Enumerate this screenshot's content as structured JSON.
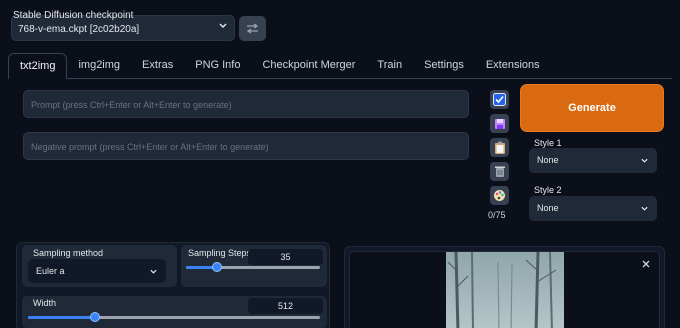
{
  "checkpoint": {
    "label": "Stable Diffusion checkpoint",
    "value": "768-v-ema.ckpt [2c02b20a]"
  },
  "tabs": [
    {
      "label": "txt2img"
    },
    {
      "label": "img2img"
    },
    {
      "label": "Extras"
    },
    {
      "label": "PNG Info"
    },
    {
      "label": "Checkpoint Merger"
    },
    {
      "label": "Train"
    },
    {
      "label": "Settings"
    },
    {
      "label": "Extensions"
    }
  ],
  "prompt": {
    "placeholder": "Prompt (press Ctrl+Enter or Alt+Enter to generate)",
    "negative_placeholder": "Negative prompt (press Ctrl+Enter or Alt+Enter to generate)",
    "token_count": "0/75"
  },
  "generate": {
    "label": "Generate"
  },
  "styles": {
    "style1_label": "Style 1",
    "style1_value": "None",
    "style2_label": "Style 2",
    "style2_value": "None"
  },
  "sampling": {
    "method_label": "Sampling method",
    "method_value": "Euler a",
    "steps_label": "Sampling Steps",
    "steps_value": "35",
    "steps_fraction": 0.23
  },
  "width": {
    "label": "Width",
    "value": "512",
    "fraction": 0.23
  },
  "colors": {
    "background": "#0b0f19",
    "accent_orange": "#d96a11",
    "slider_blue": "#3b82f6"
  },
  "icons": [
    "refresh-icon",
    "chevron-down-icon",
    "checkbox-icon",
    "save-icon",
    "clipboard-icon",
    "trash-icon",
    "palette-icon",
    "close-icon"
  ]
}
